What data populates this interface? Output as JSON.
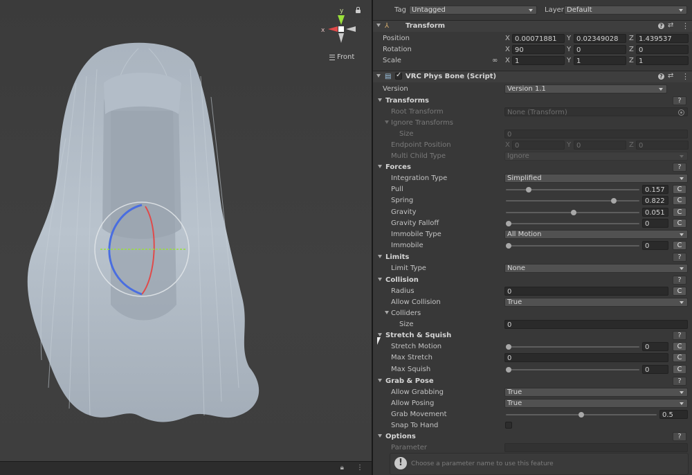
{
  "scene": {
    "gizmo": {
      "y_label": "y",
      "x_label": "x",
      "view_label": "Front"
    },
    "bottom_bar_icon": "lock-icon",
    "colors": {
      "background": "#3f3f3f",
      "hair": "#b7c1cc",
      "x_axis": "#e04a4a",
      "y_axis": "#9ae03a",
      "z_axis": "#4a6ee0"
    }
  },
  "inspector": {
    "top": {
      "tag_label": "Tag",
      "tag_value": "Untagged",
      "layer_label": "Layer",
      "layer_value": "Default"
    },
    "transform": {
      "title": "Transform",
      "position": {
        "label": "Position",
        "x": "0.00071881",
        "y": "0.02349028",
        "z": "1.439537"
      },
      "rotation": {
        "label": "Rotation",
        "x": "90",
        "y": "0",
        "z": "0"
      },
      "scale": {
        "label": "Scale",
        "x": "1",
        "y": "1",
        "z": "1"
      },
      "axis_x": "X",
      "axis_y": "Y",
      "axis_z": "Z"
    },
    "physbone": {
      "title": "VRC Phys Bone (Script)",
      "version_label": "Version",
      "version_value": "Version 1.1",
      "transforms": {
        "title": "Transforms",
        "root_transform_label": "Root Transform",
        "root_transform_value": "None (Transform)",
        "ignore_transforms_label": "Ignore Transforms",
        "size_label": "Size",
        "size_value": "0",
        "endpoint_label": "Endpoint Position",
        "endpoint_x": "0",
        "endpoint_y": "0",
        "endpoint_z": "0",
        "multi_child_label": "Multi Child Type",
        "multi_child_value": "Ignore"
      },
      "forces": {
        "title": "Forces",
        "integration_label": "Integration Type",
        "integration_value": "Simplified",
        "pull_label": "Pull",
        "pull_value": "0.157",
        "pull_level": 0.157,
        "spring_label": "Spring",
        "spring_value": "0.822",
        "spring_level": 0.822,
        "gravity_label": "Gravity",
        "gravity_value": "0.051",
        "gravity_level": 0.51,
        "gravity_falloff_label": "Gravity Falloff",
        "gravity_falloff_value": "0",
        "gravity_falloff_level": 0,
        "immobile_type_label": "Immobile Type",
        "immobile_type_value": "All Motion",
        "immobile_label": "Immobile",
        "immobile_value": "0",
        "immobile_level": 0
      },
      "limits": {
        "title": "Limits",
        "limit_type_label": "Limit Type",
        "limit_type_value": "None"
      },
      "collision": {
        "title": "Collision",
        "radius_label": "Radius",
        "radius_value": "0",
        "allow_collision_label": "Allow Collision",
        "allow_collision_value": "True",
        "colliders_label": "Colliders",
        "size_label": "Size",
        "size_value": "0"
      },
      "stretch": {
        "title": "Stretch & Squish",
        "stretch_motion_label": "Stretch Motion",
        "stretch_motion_value": "0",
        "stretch_motion_level": 0,
        "max_stretch_label": "Max Stretch",
        "max_stretch_value": "0",
        "max_squish_label": "Max Squish",
        "max_squish_value": "0",
        "max_squish_level": 0
      },
      "grab": {
        "title": "Grab & Pose",
        "allow_grabbing_label": "Allow Grabbing",
        "allow_grabbing_value": "True",
        "allow_posing_label": "Allow Posing",
        "allow_posing_value": "True",
        "grab_movement_label": "Grab Movement",
        "grab_movement_value": "0.5",
        "grab_movement_level": 0.5,
        "snap_label": "Snap To Hand"
      },
      "options": {
        "title": "Options",
        "parameter_label": "Parameter",
        "help_text": "Choose a parameter name to use this feature"
      },
      "c_label": "C",
      "q_label": "?"
    }
  }
}
